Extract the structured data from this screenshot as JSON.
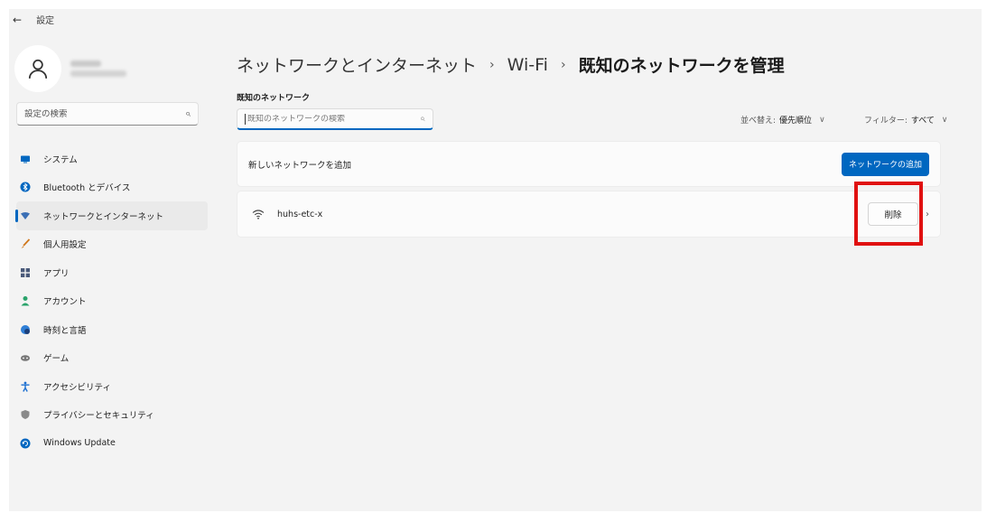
{
  "window": {
    "title": "設定",
    "back_icon": "back-arrow-icon"
  },
  "sidebar": {
    "search_placeholder": "設定の検索",
    "items": [
      {
        "label": "システム",
        "icon": "monitor-icon",
        "color": "#0067c0"
      },
      {
        "label": "Bluetooth とデバイス",
        "icon": "bluetooth-icon",
        "color": "#0067c0"
      },
      {
        "label": "ネットワークとインターネット",
        "icon": "network-icon",
        "color": "#3a6fb5",
        "active": true
      },
      {
        "label": "個人用設定",
        "icon": "brush-icon",
        "color": "#d0781c"
      },
      {
        "label": "アプリ",
        "icon": "apps-icon",
        "color": "#4a5a7a"
      },
      {
        "label": "アカウント",
        "icon": "account-icon",
        "color": "#2aa36b"
      },
      {
        "label": "時刻と言語",
        "icon": "globe-clock-icon",
        "color": "#2f7fd6"
      },
      {
        "label": "ゲーム",
        "icon": "gamepad-icon",
        "color": "#777777"
      },
      {
        "label": "アクセシビリティ",
        "icon": "accessibility-icon",
        "color": "#1c6fd1"
      },
      {
        "label": "プライバシーとセキュリティ",
        "icon": "shield-icon",
        "color": "#8a8a8a"
      },
      {
        "label": "Windows Update",
        "icon": "update-icon",
        "color": "#0067c0"
      }
    ]
  },
  "breadcrumb": {
    "items": [
      "ネットワークとインターネット",
      "Wi-Fi",
      "既知のネットワークを管理"
    ]
  },
  "main": {
    "section_label": "既知のネットワーク",
    "search_placeholder": "既知のネットワークの検索",
    "sort_label": "並べ替え:",
    "sort_value": "優先順位",
    "filter_label": "フィルター:",
    "filter_value": "すべて",
    "add_network_label": "新しいネットワークを追加",
    "add_network_button": "ネットワークの追加",
    "networks": [
      {
        "ssid": "huhs-etc-x",
        "remove_label": "削除"
      }
    ]
  },
  "colors": {
    "accent": "#0067c0",
    "highlight": "#e01010"
  }
}
